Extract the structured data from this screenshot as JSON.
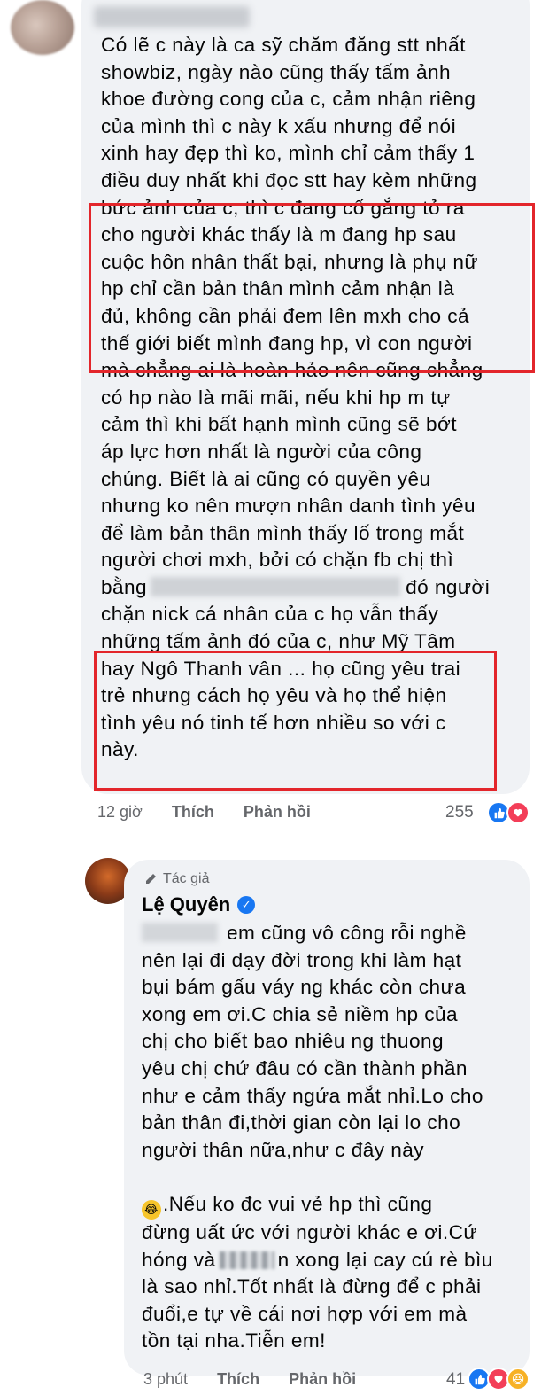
{
  "comment1": {
    "lines": [
      "Có lẽ c này là ca sỹ chăm đăng stt nhất",
      "showbiz, ngày nào cũng thấy tấm ảnh",
      "khoe đường cong của c, cảm nhận riêng",
      "của mình thì c này k xấu nhưng để nói",
      "xinh hay đẹp thì ko, mình chỉ cảm thấy 1",
      "điều duy nhất khi đọc stt hay kèm những",
      "bức ảnh của c, thì c đang cố gắng tỏ ra",
      "cho người khác thấy là m đang hp sau",
      "cuộc hôn nhân thất bại, nhưng là phụ nữ",
      "hp chỉ cần bản thân mình cảm nhận là",
      "đủ, không cần phải đem lên mxh cho cả",
      "thế giới biết mình đang hp, vì con người",
      "mà chẳng ai là hoàn hảo nên cũng chẳng",
      "có hp nào là mãi mãi, nếu khi hp m tự",
      "cảm thì khi bất hạnh mình cũng sẽ bớt",
      "áp lực hơn nhất là người của công",
      "chúng. Biết là ai cũng có quyền yêu",
      "nhưng ko nên mượn nhân danh tình yêu",
      "để làm bản thân mình thấy lố trong mắt",
      "người chơi mxh, bởi có chặn fb chị thì"
    ],
    "line21_start": "bằng",
    "line21_end": "đó người",
    "lines_after": [
      "chặn nick cá nhân của c họ vẫn thấy",
      "những tấm ảnh đó của c, như Mỹ Tâm",
      "hay Ngô Thanh vân ... họ cũng yêu trai",
      "trẻ nhưng cách họ yêu và họ thể hiện",
      "tình yêu nó tinh tế hơn nhiều so với c",
      "này."
    ],
    "time": "12 giờ",
    "like_label": "Thích",
    "reply_label": "Phản hồi",
    "reaction_count": "255"
  },
  "reply": {
    "badge": "Tác giả",
    "author": "Lệ Quyên",
    "first_line_rest": "em cũng vô công rỗi nghề",
    "lines": [
      "nên lại đi dạy đời trong khi làm hạt",
      "bụi bám gấu váy ng khác còn chưa",
      "xong em ơi.C chia sẻ niềm hp của",
      "chị cho biết bao nhiêu ng thuong",
      "yêu chị chứ đâu có cần thành phần",
      "như e cảm thấy ngứa mắt nhỉ.Lo cho",
      "bản thân đi,thời gian còn lại lo cho",
      "người thân nữa,như c đây này"
    ],
    "emoji_line_rest": ".Nếu ko đc vui vẻ hp thì cũng",
    "lines2": [
      "đừng uất ức với người khác e ơi.Cứ"
    ],
    "line_blur_start": "hóng và",
    "line_blur_end": "n xong lại cay cú rè bìu",
    "lines3": [
      "là sao nhỉ.Tốt nhất là đừng để c phải",
      "đuổi,e tự về cái nơi hợp với em mà",
      "tồn tại nha.Tiễn em!"
    ],
    "time": "3 phút",
    "like_label": "Thích",
    "reply_label": "Phản hồi",
    "reaction_count": "41"
  },
  "icons": {
    "like": "thumbs-up-icon",
    "love": "heart-icon",
    "haha": "laughing-face-icon",
    "verified": "verified-check-icon",
    "author_badge": "pen-icon"
  },
  "colors": {
    "bubble": "#f0f2f5",
    "highlight_box": "#e3262b",
    "meta_text": "#65676b",
    "like_blue": "#1877f2",
    "love_red": "#f33e58"
  }
}
